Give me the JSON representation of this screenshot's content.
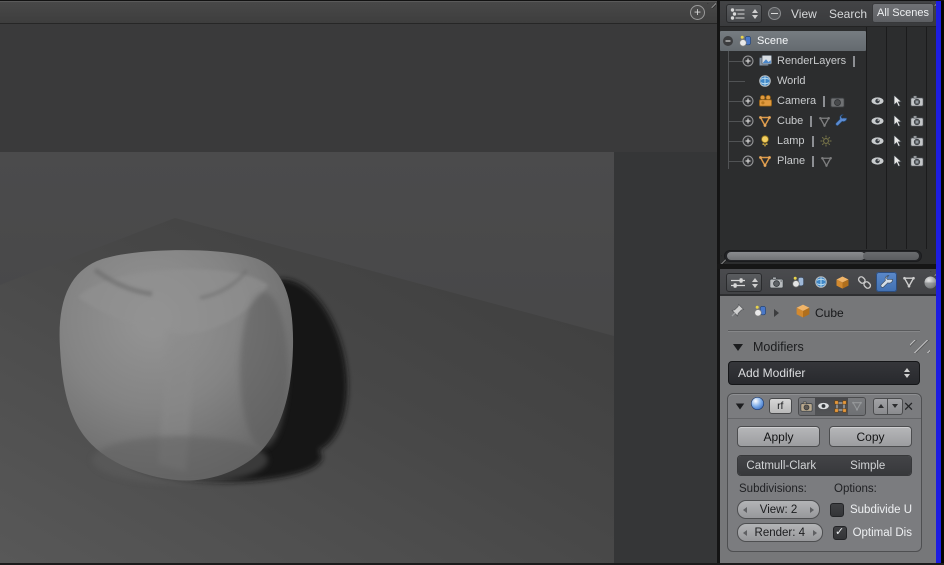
{
  "outliner": {
    "header": {
      "view": "View",
      "search": "Search",
      "all_scenes": "All Scenes"
    },
    "rows": [
      {
        "label": "Scene",
        "selected": true
      },
      {
        "label": "RenderLayers",
        "selected": false
      },
      {
        "label": "World",
        "selected": false
      },
      {
        "label": "Camera",
        "selected": false
      },
      {
        "label": "Cube",
        "selected": false
      },
      {
        "label": "Lamp",
        "selected": false
      },
      {
        "label": "Plane",
        "selected": false
      }
    ]
  },
  "properties": {
    "tabs": [
      {
        "name": "render",
        "active": false
      },
      {
        "name": "scene",
        "active": false
      },
      {
        "name": "world",
        "active": false
      },
      {
        "name": "object",
        "active": false
      },
      {
        "name": "constraints",
        "active": false
      },
      {
        "name": "modifiers",
        "active": true
      },
      {
        "name": "object-data",
        "active": false
      },
      {
        "name": "material",
        "active": false
      }
    ],
    "breadcrumb": {
      "object_name": "Cube"
    },
    "modifiers_panel": {
      "title": "Modifiers",
      "add_modifier_label": "Add Modifier",
      "modifier": {
        "name_field": "rf",
        "apply_label": "Apply",
        "copy_label": "Copy",
        "type_options": [
          "Catmull-Clark",
          "Simple"
        ],
        "active_type": "Catmull-Clark",
        "type_catmull_active": true,
        "type_simple_active": false,
        "subdivisions_label": "Subdivisions:",
        "options_label": "Options:",
        "view_value": "View: 2",
        "render_value": "Render: 4",
        "subdivide_uv": {
          "label": "Subdivide U",
          "checked": false
        },
        "optimal_display": {
          "label": "Optimal Dis",
          "checked": true
        }
      }
    }
  },
  "viewport": {
    "content": "Subdivided smooth cube casting shadow on plane"
  },
  "icons": {
    "check_glyph": "✓",
    "close_glyph": "✕",
    "plus_glyph": "+"
  },
  "colors": {
    "accent_blue": "#4a7dc8",
    "selection_gray": "#6e7479",
    "edge_highlight_blue": "#1d1de0",
    "panel_gray": "#767779",
    "outliner_bg": "#2c2d2e",
    "viewport_bg": "#3a3a3b"
  }
}
